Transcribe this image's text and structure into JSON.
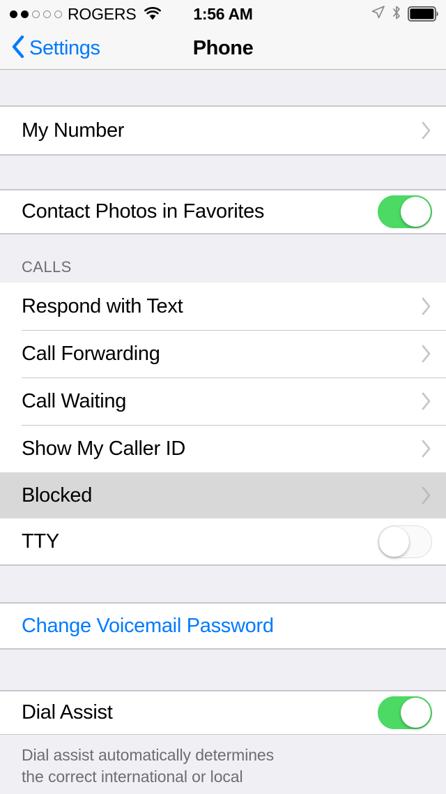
{
  "status_bar": {
    "carrier": "ROGERS",
    "signal_dots_filled": 2,
    "signal_dots_total": 5,
    "wifi_icon": "wifi-icon",
    "time": "1:56 AM",
    "location_icon": "location-arrow-icon",
    "bluetooth_icon": "bluetooth-icon",
    "battery_icon": "battery-icon"
  },
  "nav": {
    "back_label": "Settings",
    "back_icon": "chevron-left-icon",
    "title": "Phone"
  },
  "sections": [
    {
      "header": "",
      "rows": [
        {
          "label": "My Number",
          "type": "disclosure",
          "accessory": "chevron-right-icon",
          "highlighted": false
        }
      ],
      "footer": ""
    },
    {
      "header": "",
      "rows": [
        {
          "label": "Contact Photos in Favorites",
          "type": "toggle",
          "toggle_on": true,
          "highlighted": false
        }
      ],
      "footer": ""
    },
    {
      "header": "CALLS",
      "rows": [
        {
          "label": "Respond with Text",
          "type": "disclosure",
          "accessory": "chevron-right-icon",
          "highlighted": false
        },
        {
          "label": "Call Forwarding",
          "type": "disclosure",
          "accessory": "chevron-right-icon",
          "highlighted": false
        },
        {
          "label": "Call Waiting",
          "type": "disclosure",
          "accessory": "chevron-right-icon",
          "highlighted": false
        },
        {
          "label": "Show My Caller ID",
          "type": "disclosure",
          "accessory": "chevron-right-icon",
          "highlighted": false
        },
        {
          "label": "Blocked",
          "type": "disclosure",
          "accessory": "chevron-right-icon",
          "highlighted": true
        },
        {
          "label": "TTY",
          "type": "toggle",
          "toggle_on": false,
          "highlighted": false
        }
      ],
      "footer": ""
    },
    {
      "header": "",
      "rows": [
        {
          "label": "Change Voicemail Password",
          "type": "link",
          "highlighted": false
        }
      ],
      "footer": ""
    },
    {
      "header": "",
      "rows": [
        {
          "label": "Dial Assist",
          "type": "toggle",
          "toggle_on": true,
          "highlighted": false
        }
      ],
      "footer": "Dial assist automatically determines\nthe correct international or local"
    }
  ],
  "colors": {
    "accent_blue": "#007AFF",
    "toggle_on_green": "#4CD964",
    "row_highlight_gray": "#D8D8D8",
    "group_background": "#EFEFF4",
    "row_background": "#FFFFFF",
    "separator": "#C8C7CC",
    "secondary_text": "#6D6D72"
  }
}
